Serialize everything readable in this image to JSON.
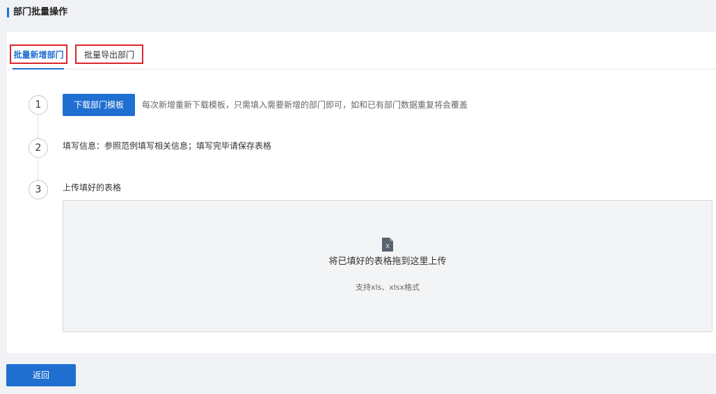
{
  "header": {
    "title": "部门批量操作"
  },
  "tabs": [
    {
      "label": "批量新增部门",
      "active": true
    },
    {
      "label": "批量导出部门",
      "active": false
    }
  ],
  "steps": [
    {
      "number": "1",
      "button_label": "下载部门模板",
      "description": "每次新增重新下载模板，只需填入需要新增的部门即可，如和已有部门数据重复将会覆盖"
    },
    {
      "number": "2",
      "text": "填写信息：参照范例填写相关信息；填写完毕请保存表格"
    },
    {
      "number": "3",
      "text": "上传填好的表格"
    }
  ],
  "upload": {
    "icon": "excel-file-icon",
    "icon_letter": "X",
    "main_text": "将已填好的表格拖到这里上传",
    "sub_text": "支持xls、xlsx格式"
  },
  "footer": {
    "back_label": "返回"
  },
  "colors": {
    "primary": "#1f6fd1",
    "highlight_border": "#d9262c",
    "background": "#f0f2f5",
    "dropzone_bg": "#f3f4f5"
  }
}
